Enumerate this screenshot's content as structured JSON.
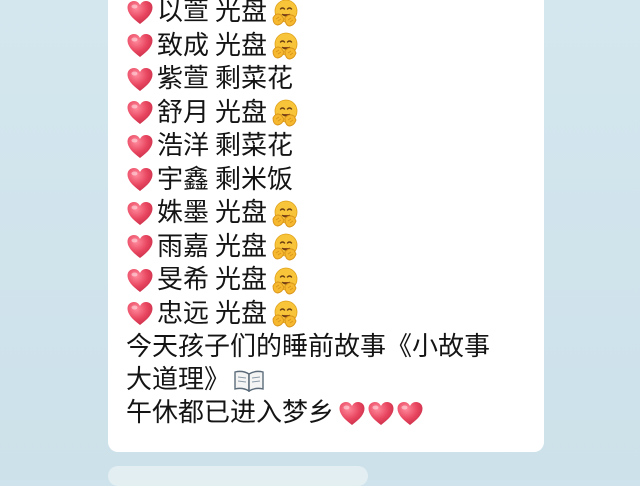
{
  "messages": [
    {
      "name": "以萱",
      "status": "光盘",
      "emoji": "hug"
    },
    {
      "name": "致成",
      "status": "光盘",
      "emoji": "hug"
    },
    {
      "name": "紫萱",
      "status": "剩菜花",
      "emoji": ""
    },
    {
      "name": "舒月",
      "status": "光盘",
      "emoji": "hug"
    },
    {
      "name": "浩洋",
      "status": "剩菜花",
      "emoji": ""
    },
    {
      "name": "宇鑫",
      "status": "剩米饭",
      "emoji": ""
    },
    {
      "name": "姝墨",
      "status": "光盘",
      "emoji": "hug"
    },
    {
      "name": "雨嘉",
      "status": "光盘",
      "emoji": "hug"
    },
    {
      "name": "旻希",
      "status": "光盘",
      "emoji": "hug"
    },
    {
      "name": "忠远",
      "status": "光盘",
      "emoji": "hug"
    }
  ],
  "story_line1": "今天孩子们的睡前故事《小故事",
  "story_line2": "大道理》",
  "nap_line": "午休都已进入梦乡",
  "icons": {
    "heart": "heart-icon",
    "hug": "hugging-face-icon",
    "book": "open-book-icon"
  },
  "colors": {
    "heart": "#e8455f",
    "hug_face": "#f7c43a",
    "bubble": "#ffffff",
    "background": "#cfe3ec"
  }
}
